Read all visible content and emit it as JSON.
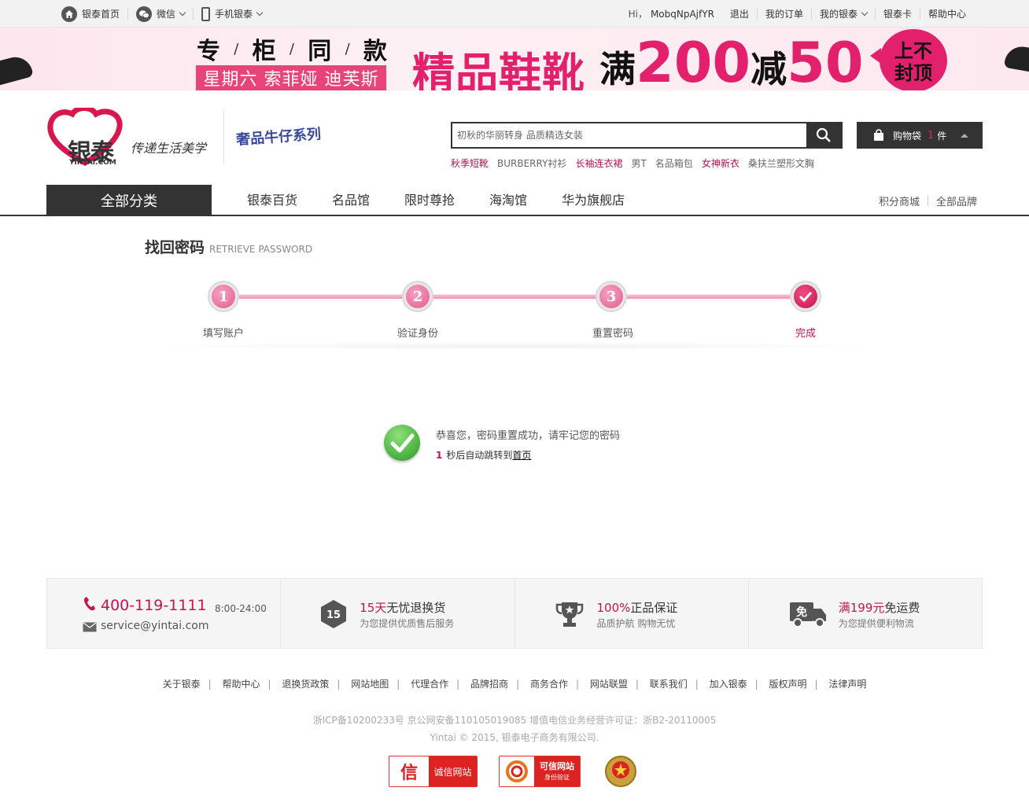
{
  "topbar": {
    "home": "银泰首页",
    "wechat": "微信",
    "mobile": "手机银泰",
    "greeting": "Hi，",
    "username": "MobqNpAjfYR",
    "logout": "退出",
    "orders": "我的订单",
    "my_yintai": "我的银泰",
    "card": "银泰卡",
    "help": "帮助中心"
  },
  "banner": {
    "line1": [
      "专",
      "柜",
      "同",
      "款"
    ],
    "line1_sep": "/",
    "line2": "星期六 索菲娅 迪芙斯",
    "headline": "精品鞋靴",
    "promo_prefix": "满",
    "promo_amount1": "200",
    "promo_mid": "减",
    "promo_amount2": "50",
    "badge": "上不封顶"
  },
  "header": {
    "logo_text": "银泰",
    "logo_domain": "YINTAI.COM",
    "slogan": "传递生活美学",
    "series": "奢品牛仔系列",
    "search_placeholder": "初秋的华丽转身 品质精选女装",
    "hotwords": [
      {
        "text": "秋季短靴",
        "hl": true
      },
      {
        "text": "BURBERRY衬衫",
        "hl": false
      },
      {
        "text": "长袖连衣裙",
        "hl": true
      },
      {
        "text": "男T",
        "hl": false
      },
      {
        "text": "名品箱包",
        "hl": false
      },
      {
        "text": "女神新衣",
        "hl": true
      },
      {
        "text": "桑扶兰塑形文胸",
        "hl": false
      }
    ],
    "cart_label": "购物袋",
    "cart_count": "1",
    "cart_unit": "件"
  },
  "nav": {
    "all": "全部分类",
    "items": [
      "银泰百货",
      "名品馆",
      "限时尊抢",
      "海淘馆",
      "华为旗舰店"
    ],
    "points_mall": "积分商城",
    "all_brands": "全部品牌"
  },
  "page": {
    "title": "找回密码",
    "title_en": "RETRIEVE PASSWORD",
    "steps": [
      {
        "num": "1",
        "label": "填写账户"
      },
      {
        "num": "2",
        "label": "验证身份"
      },
      {
        "num": "3",
        "label": "重置密码"
      },
      {
        "num": "",
        "label": "完成"
      }
    ],
    "success_msg": "恭喜您，密码重置成功，请牢记您的密码",
    "countdown": "1",
    "redirect_text": "秒后自动跳转到",
    "redirect_link": "首页"
  },
  "service": {
    "phone": "400-119-1111",
    "hours": "8:00-24:00",
    "email": "service@yintai.com",
    "return_days": "15",
    "return_title_hl": "15天",
    "return_title": "无忧退换货",
    "return_sub": "为您提供优质售后服务",
    "genuine_title_hl": "100%",
    "genuine_title": "正品保证",
    "genuine_sub": "品质护航 购物无忧",
    "ship_icon": "免",
    "ship_title_hl": "满199元",
    "ship_title": "免运费",
    "ship_sub": "为您提供便利物流"
  },
  "footer": {
    "links": [
      "关于银泰",
      "帮助中心",
      "退换货政策",
      "网站地图",
      "代理合作",
      "品牌招商",
      "商务合作",
      "网站联盟",
      "联系我们",
      "加入银泰",
      "版权声明",
      "法律声明"
    ],
    "icp": "浙ICP备10200233号 京公网安备110105019085 增值电信业务经营许可证：浙B2-20110005",
    "copyright": "Yintai © 2015, 银泰电子商务有限公司.",
    "badge1_left": "信",
    "badge1_text": "诚信网站",
    "badge2_text": "可信网站",
    "badge2_sub": "身份验证"
  },
  "colors": {
    "accent": "#c7134f",
    "dark": "#333333",
    "pink": "#e2206c"
  }
}
